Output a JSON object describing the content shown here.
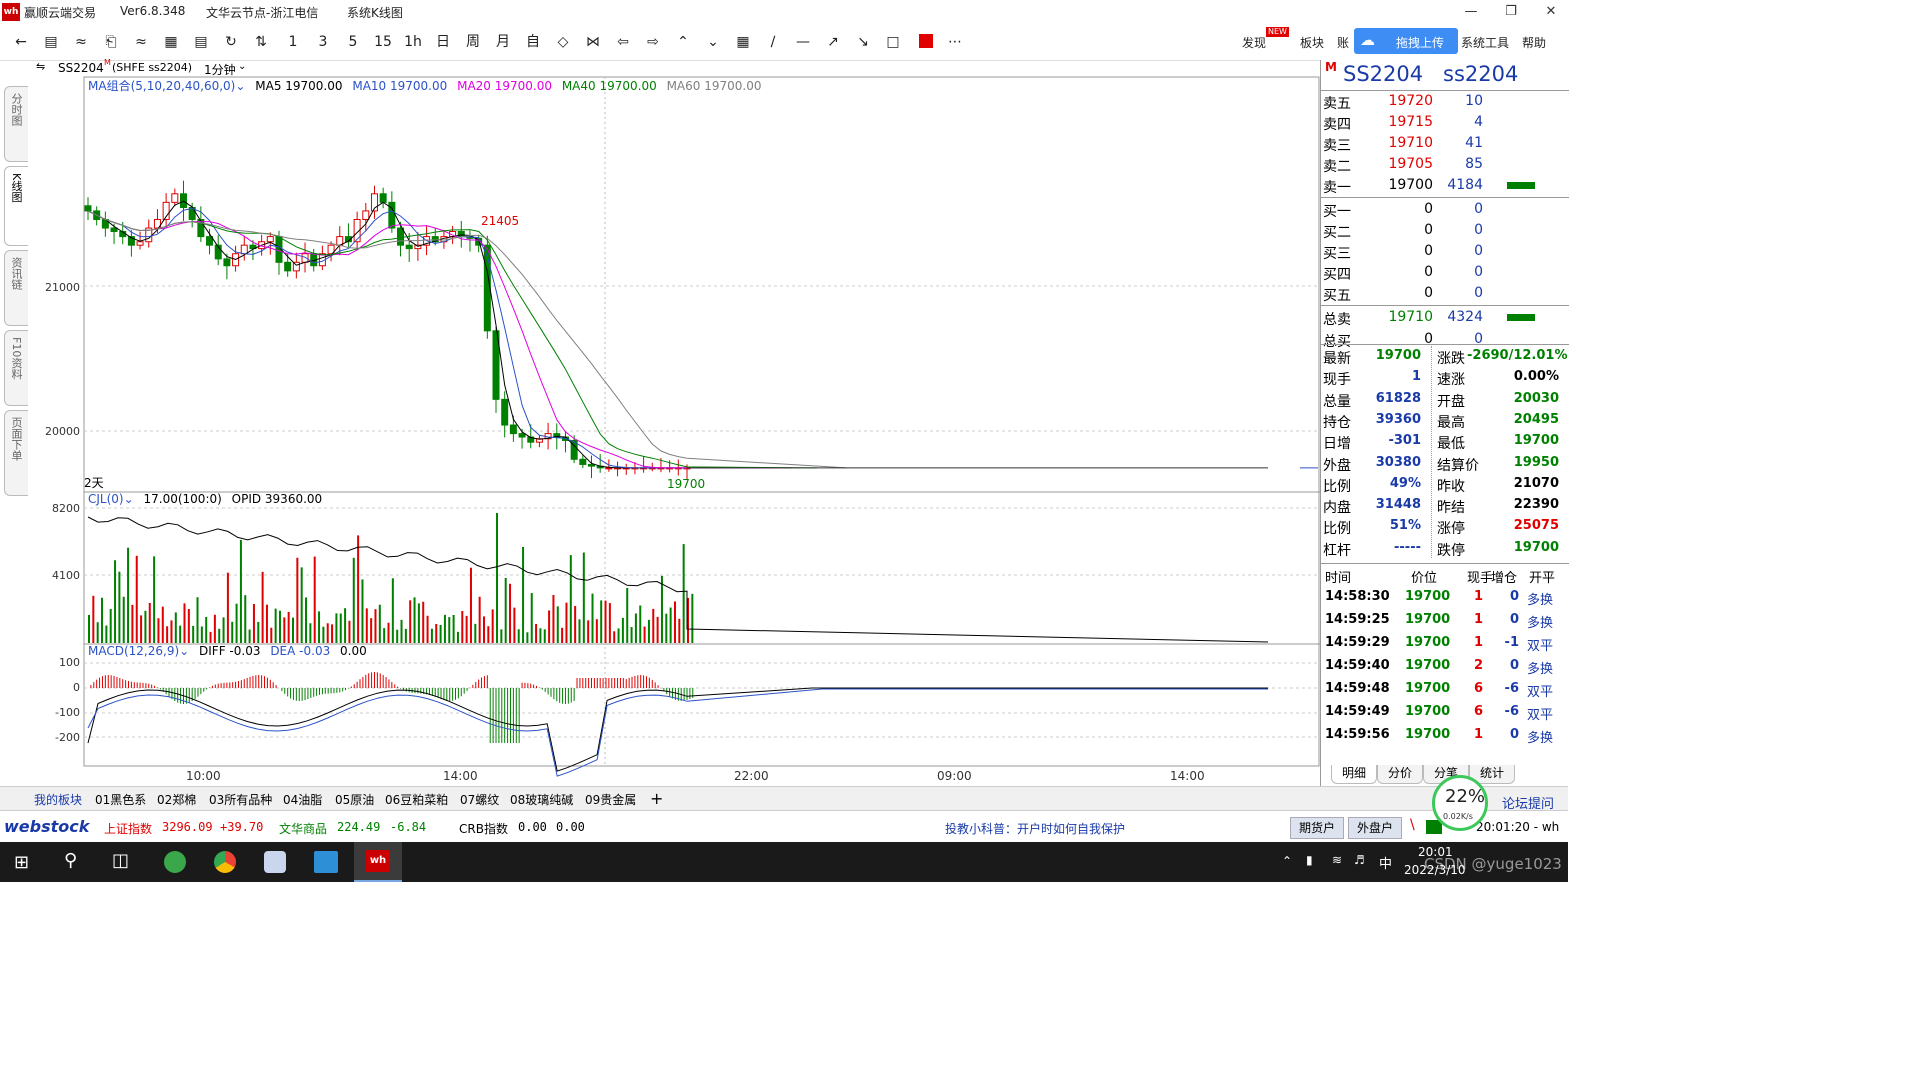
{
  "app": {
    "title": "赢顺云端交易",
    "version": "Ver6.8.348",
    "node": "文华云节点-浙江电信",
    "window": "系统K线图"
  },
  "toolbar": {
    "periods": [
      "1",
      "3",
      "5",
      "15",
      "1h",
      "日",
      "周",
      "月",
      "自"
    ],
    "right_items": [
      "发现",
      "板块",
      "账",
      "拖拽上传",
      "系统工具",
      "帮助"
    ],
    "new_badge": "NEW"
  },
  "side_tabs": [
    {
      "label": "分时图"
    },
    {
      "label": "K线图"
    },
    {
      "label": "资讯链"
    },
    {
      "label": "F10资料"
    },
    {
      "label": "页面下单"
    }
  ],
  "chart_header": {
    "symbol": "SS2204",
    "symbol_sup": "M",
    "exchange": "(SHFE ss2204)",
    "period": "1分钟"
  },
  "ma_legend": [
    {
      "text": "MA组合(5,10,20,40,60,0)",
      "color": "#2b52c8"
    },
    {
      "text": "MA5 19700.00",
      "color": "#000000"
    },
    {
      "text": "MA10 19700.00",
      "color": "#2b52c8"
    },
    {
      "text": "MA20 19700.00",
      "color": "#e000e0"
    },
    {
      "text": "MA40 19700.00",
      "color": "#008000"
    },
    {
      "text": "MA60 19700.00",
      "color": "#808080"
    }
  ],
  "vol_legend": [
    {
      "text": "CJL(0)",
      "color": "#2b52c8"
    },
    {
      "text": "17.00(100:0)",
      "color": "#000000"
    },
    {
      "text": "OPID 39360.00",
      "color": "#000000"
    }
  ],
  "macd_legend": [
    {
      "text": "MACD(12,26,9)",
      "color": "#2b52c8"
    },
    {
      "text": "DIFF -0.03",
      "color": "#000000"
    },
    {
      "text": "DEA -0.03",
      "color": "#2b52c8"
    },
    {
      "text": "0.00",
      "color": "#000000"
    }
  ],
  "chart_data": {
    "type": "candlestick",
    "price_axis_ticks": [
      "21000",
      "20000"
    ],
    "volume_axis_ticks": [
      "8200",
      "4100"
    ],
    "macd_axis_ticks": [
      "100",
      "0",
      "-100",
      "-200"
    ],
    "time_labels": [
      "10:00",
      "14:00",
      "22:00",
      "09:00",
      "14:00"
    ],
    "high_label": "21405",
    "low_label": "19700",
    "days_label": "2天",
    "price_close": [
      21200,
      21150,
      21100,
      21080,
      21050,
      21000,
      21020,
      21100,
      21150,
      21250,
      21300,
      21220,
      21150,
      21050,
      21000,
      20920,
      20880,
      20950,
      21000,
      20980,
      21020,
      21050,
      20900,
      20850,
      20900,
      20950,
      20880,
      20950,
      21000,
      21050,
      21020,
      21150,
      21200,
      21300,
      21250,
      21100,
      21000,
      20980,
      21000,
      21050,
      21020,
      21050,
      21080,
      21050,
      21040,
      21000,
      20500,
      20100,
      19950,
      19900,
      19880,
      19850,
      19870,
      19900,
      19880,
      19860,
      19750,
      19720,
      19710,
      19700,
      19700,
      19700,
      19700,
      19700,
      19700,
      19700,
      19700,
      19700,
      19700,
      19700
    ],
    "price_range": [
      19600,
      21900
    ]
  },
  "quote": {
    "code": "SS2204",
    "name": "ss2204",
    "sell": [
      {
        "label": "卖五",
        "price": "19720",
        "vol": "10"
      },
      {
        "label": "卖四",
        "price": "19715",
        "vol": "4"
      },
      {
        "label": "卖三",
        "price": "19710",
        "vol": "41"
      },
      {
        "label": "卖二",
        "price": "19705",
        "vol": "85"
      },
      {
        "label": "卖一",
        "price": "19700",
        "vol": "4184"
      }
    ],
    "buy": [
      {
        "label": "买一",
        "price": "0",
        "vol": "0"
      },
      {
        "label": "买二",
        "price": "0",
        "vol": "0"
      },
      {
        "label": "买三",
        "price": "0",
        "vol": "0"
      },
      {
        "label": "买四",
        "price": "0",
        "vol": "0"
      },
      {
        "label": "买五",
        "price": "0",
        "vol": "0"
      }
    ],
    "total_sell": {
      "label": "总卖",
      "price": "19710",
      "vol": "4324"
    },
    "total_buy": {
      "label": "总买",
      "price": "0",
      "vol": "0"
    },
    "stats_left": [
      {
        "label": "最新",
        "value": "19700",
        "color": "#008000"
      },
      {
        "label": "现手",
        "value": "1",
        "color": "#1a3aa8"
      },
      {
        "label": "总量",
        "value": "61828",
        "color": "#1a3aa8"
      },
      {
        "label": "持仓",
        "value": "39360",
        "color": "#1a3aa8"
      },
      {
        "label": "日增",
        "value": "-301",
        "color": "#1a3aa8"
      },
      {
        "label": "外盘",
        "value": "30380",
        "color": "#1a3aa8"
      },
      {
        "label": "比例",
        "value": "49%",
        "color": "#1a3aa8"
      },
      {
        "label": "内盘",
        "value": "31448",
        "color": "#1a3aa8"
      },
      {
        "label": "比例",
        "value": "51%",
        "color": "#1a3aa8"
      },
      {
        "label": "杠杆",
        "value": "-----",
        "color": "#1a3aa8"
      }
    ],
    "stats_right": [
      {
        "label": "涨跌",
        "value": "-2690/12.01%",
        "color": "#008000"
      },
      {
        "label": "速涨",
        "value": "0.00%",
        "color": "#000000"
      },
      {
        "label": "开盘",
        "value": "20030",
        "color": "#008000"
      },
      {
        "label": "最高",
        "value": "20495",
        "color": "#008000"
      },
      {
        "label": "最低",
        "value": "19700",
        "color": "#008000"
      },
      {
        "label": "结算价",
        "value": "19950",
        "color": "#008000"
      },
      {
        "label": "昨收",
        "value": "21070",
        "color": "#000000"
      },
      {
        "label": "昨结",
        "value": "22390",
        "color": "#000000"
      },
      {
        "label": "涨停",
        "value": "25075",
        "color": "#e00000"
      },
      {
        "label": "跌停",
        "value": "19700",
        "color": "#008000"
      }
    ],
    "ticks_header": [
      "时间",
      "价位",
      "现手",
      "增仓",
      "开平"
    ],
    "ticks": [
      {
        "time": "14:58:30",
        "price": "19700",
        "hand": "1",
        "inc": "0",
        "type": "多换"
      },
      {
        "time": "14:59:25",
        "price": "19700",
        "hand": "1",
        "inc": "0",
        "type": "多换"
      },
      {
        "time": "14:59:29",
        "price": "19700",
        "hand": "1",
        "inc": "-1",
        "type": "双平"
      },
      {
        "time": "14:59:40",
        "price": "19700",
        "hand": "2",
        "inc": "0",
        "type": "多换"
      },
      {
        "time": "14:59:48",
        "price": "19700",
        "hand": "6",
        "inc": "-6",
        "type": "双平"
      },
      {
        "time": "14:59:49",
        "price": "19700",
        "hand": "6",
        "inc": "-6",
        "type": "双平"
      },
      {
        "time": "14:59:56",
        "price": "19700",
        "hand": "1",
        "inc": "0",
        "type": "多换"
      }
    ],
    "bottom_tabs": [
      "明细",
      "分价",
      "分笔",
      "统计"
    ]
  },
  "board_tabs": [
    "我的板块",
    "01黑色系",
    "02郑棉",
    "03所有品种",
    "04油脂",
    "05原油",
    "06豆粕菜粕",
    "07螺纹",
    "08玻璃纯碱",
    "09贵金属"
  ],
  "status": {
    "logo": "webstock",
    "index1_name": "上证指数",
    "index1_value": "3296.09",
    "index1_change": "+39.70",
    "index2_name": "文华商品",
    "index2_value": "224.49",
    "index2_change": "-6.84",
    "index3_name": "CRB指数",
    "index3_value": "0.00",
    "index3_change": "0.00",
    "tip": "投教小科普：开户时如何自我保护",
    "btn1": "期货户",
    "btn2": "外盘户",
    "time": "20:01:20 - wh",
    "forum": "论坛提问",
    "speed_pct": "22%",
    "speed_rate": "0.02K/s"
  },
  "taskbar": {
    "time": "20:01",
    "date": "2022/3/10",
    "ime": "中",
    "watermark": "CSDN @yuge1023"
  }
}
